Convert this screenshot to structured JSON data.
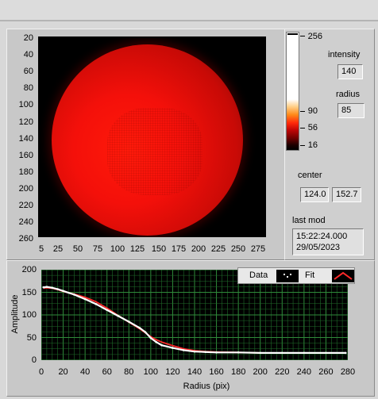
{
  "image_display": {
    "y_ticks": [
      "20",
      "40",
      "60",
      "80",
      "100",
      "120",
      "140",
      "160",
      "180",
      "200",
      "220",
      "240",
      "260"
    ],
    "x_ticks": [
      "5",
      "25",
      "50",
      "75",
      "100",
      "125",
      "150",
      "175",
      "200",
      "225",
      "250",
      "275"
    ]
  },
  "colorbar": {
    "ticks": [
      "256",
      "90",
      "56",
      "16"
    ]
  },
  "intensity": {
    "label": "intensity",
    "value": "140"
  },
  "radius": {
    "label": "radius",
    "value": "85"
  },
  "center": {
    "label": "center",
    "x": "124.0",
    "y": "152.7"
  },
  "last_mod": {
    "label": "last mod",
    "time": "15:22:24.000",
    "date": "29/05/2023"
  },
  "plot": {
    "legend_data": "Data",
    "legend_fit": "Fit",
    "colors": {
      "data": "#ffffff",
      "fit": "#ff2a2a",
      "grid": "#1f6b2a",
      "background": "#000000"
    }
  },
  "chart_data": {
    "type": "line",
    "xlabel": "Radius (pix)",
    "ylabel": "Amplitude",
    "xlim": [
      0,
      280
    ],
    "ylim": [
      0,
      200
    ],
    "x_ticks": [
      0,
      20,
      40,
      60,
      80,
      100,
      120,
      140,
      160,
      180,
      200,
      220,
      240,
      260,
      280
    ],
    "y_ticks": [
      0,
      50,
      100,
      150,
      200
    ],
    "grid": true,
    "legend": "top-right",
    "series": [
      {
        "name": "Data",
        "x": [
          2,
          5,
          10,
          15,
          20,
          30,
          40,
          50,
          60,
          70,
          80,
          90,
          95,
          100,
          105,
          110,
          120,
          130,
          140,
          150,
          160,
          180,
          200,
          220,
          240,
          260,
          278
        ],
        "y": [
          161,
          162,
          160,
          157,
          153,
          145,
          135,
          124,
          111,
          98,
          85,
          71,
          62,
          49,
          40,
          33,
          27,
          22,
          19,
          18,
          17,
          17,
          16,
          16,
          16,
          16,
          16
        ]
      },
      {
        "name": "Fit",
        "x": [
          2,
          5,
          10,
          15,
          20,
          30,
          40,
          50,
          60,
          70,
          80,
          90,
          100,
          105,
          110,
          120,
          130,
          140,
          150,
          160,
          180,
          200,
          220,
          240,
          260,
          278
        ],
        "y": [
          159,
          160,
          159,
          156,
          152,
          146,
          139,
          129,
          115,
          99,
          84,
          69,
          52,
          45,
          40,
          32,
          25,
          21,
          19,
          18,
          17,
          16,
          16,
          16,
          16,
          16
        ]
      }
    ]
  }
}
